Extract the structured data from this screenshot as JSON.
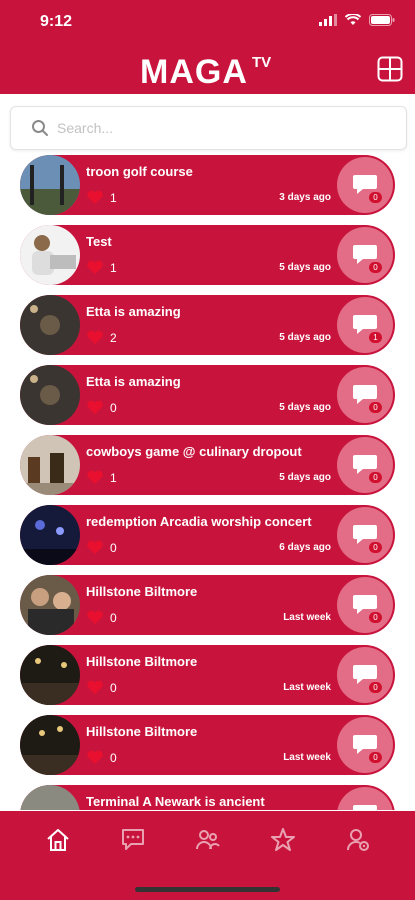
{
  "status_bar": {
    "time": "9:12"
  },
  "header": {
    "logo_main": "MAGA",
    "logo_tv": "TV"
  },
  "search": {
    "placeholder": "Search..."
  },
  "posts": [
    {
      "title": "troon golf course",
      "likes": "1",
      "time": "3 days ago",
      "comments": "0"
    },
    {
      "title": "Test",
      "likes": "1",
      "time": "5 days ago",
      "comments": "0"
    },
    {
      "title": "Etta is amazing",
      "likes": "2",
      "time": "5 days ago",
      "comments": "1"
    },
    {
      "title": "Etta is amazing",
      "likes": "0",
      "time": "5 days ago",
      "comments": "0"
    },
    {
      "title": "cowboys game @ culinary dropout",
      "likes": "1",
      "time": "5 days ago",
      "comments": "0"
    },
    {
      "title": "redemption Arcadia worship concert",
      "likes": "0",
      "time": "6 days ago",
      "comments": "0"
    },
    {
      "title": "Hillstone Biltmore",
      "likes": "0",
      "time": "Last week",
      "comments": "0"
    },
    {
      "title": "Hillstone Biltmore",
      "likes": "0",
      "time": "Last week",
      "comments": "0"
    },
    {
      "title": "Hillstone Biltmore",
      "likes": "0",
      "time": "Last week",
      "comments": "0"
    },
    {
      "title": "Terminal A Newark is ancient",
      "likes": "",
      "time": "",
      "comments": ""
    }
  ],
  "tabs": [
    "home-icon",
    "chat-icon",
    "friends-icon",
    "star-icon",
    "profile-settings-icon"
  ],
  "colors": {
    "brand": "#c8143c",
    "comment_bubble_bg": "#e36d86",
    "badge": "#d0102e"
  }
}
